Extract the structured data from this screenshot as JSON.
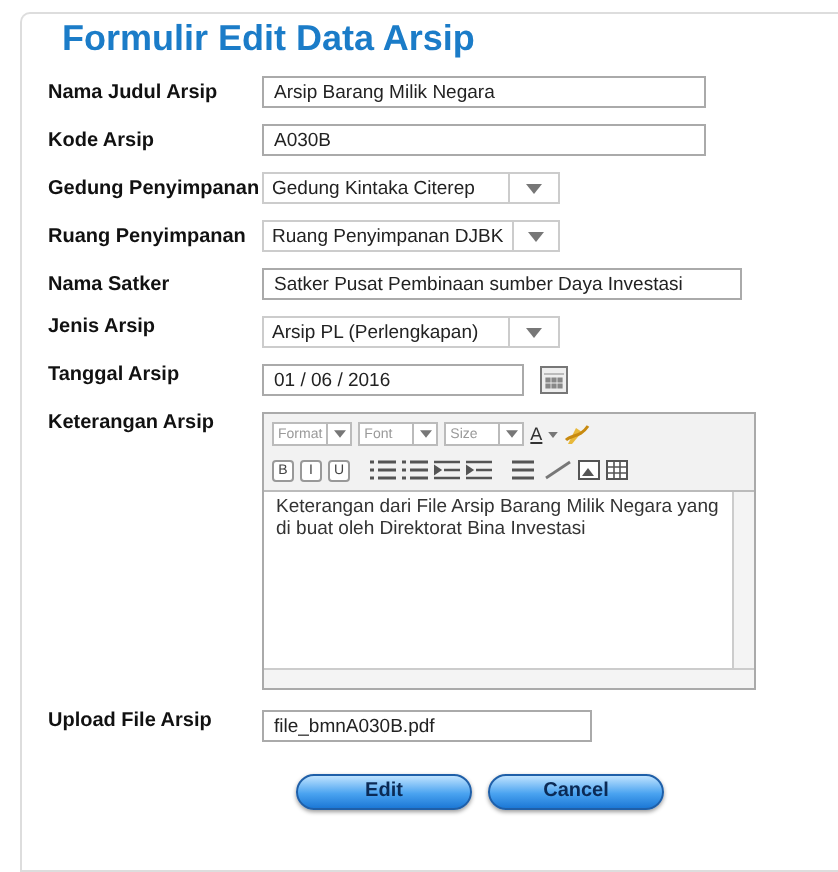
{
  "title": "Formulir Edit Data Arsip",
  "fields": [
    {
      "kind": "text",
      "label": "Nama Judul Arsip",
      "value": "Arsip Barang Milik Negara"
    },
    {
      "kind": "text",
      "label": "Kode Arsip",
      "value": "A030B"
    },
    {
      "kind": "select",
      "label": "Gedung Penyimpanan",
      "value": "Gedung Kintaka Citerep"
    },
    {
      "kind": "select",
      "label": "Ruang Penyimpanan",
      "value": "Ruang Penyimpanan DJBK"
    },
    {
      "kind": "wide",
      "label": "Nama Satker",
      "value": "Satker Pusat Pembinaan sumber Daya Investasi"
    },
    {
      "kind": "select",
      "label": "Jenis Arsip",
      "value": "Arsip PL (Perlengkapan)"
    },
    {
      "kind": "date",
      "label": "Tanggal Arsip",
      "value": "01 / 06 / 2016"
    },
    {
      "kind": "editor",
      "label": "Keterangan Arsip",
      "value": "Keterangan dari File Arsip Barang Milik Negara yang di buat oleh Direktorat Bina Investasi",
      "dropdowns": [
        "Format",
        "Font",
        "Size"
      ],
      "font_color": "A",
      "styles": [
        "B",
        "I",
        "U"
      ]
    },
    {
      "kind": "file",
      "label": "Upload File Arsip",
      "value": "file_bmnA030B.pdf"
    }
  ],
  "buttons": [
    "Edit",
    "Cancel"
  ]
}
